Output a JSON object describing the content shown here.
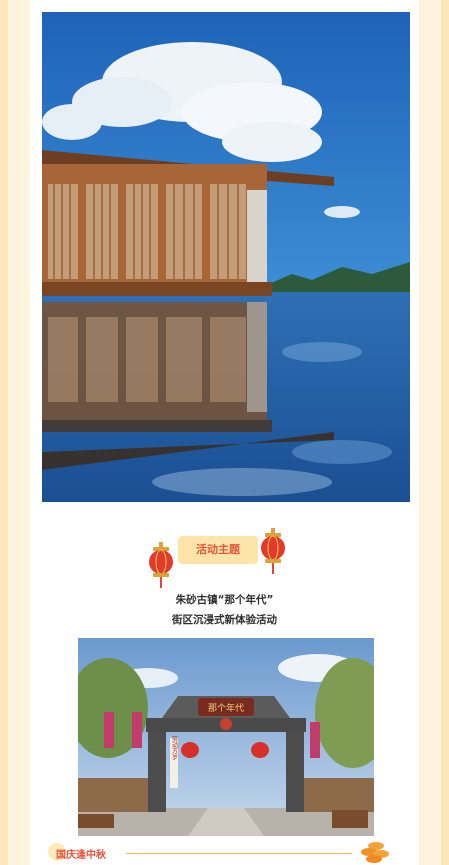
{
  "theme": {
    "badge_label": "活动主题"
  },
  "subtitle": {
    "line1": "朱砂古镇“那个年代”",
    "line2": "街区沉浸式新体验活动"
  },
  "gate": {
    "sign_text": "那个年代",
    "pillar_text": "劳动万岁"
  },
  "footer": {
    "title": "国庆逢中秋"
  },
  "colors": {
    "accent": "#e8553a",
    "badge_bg": "#fde5a9",
    "frame": "#fbe6b9"
  }
}
